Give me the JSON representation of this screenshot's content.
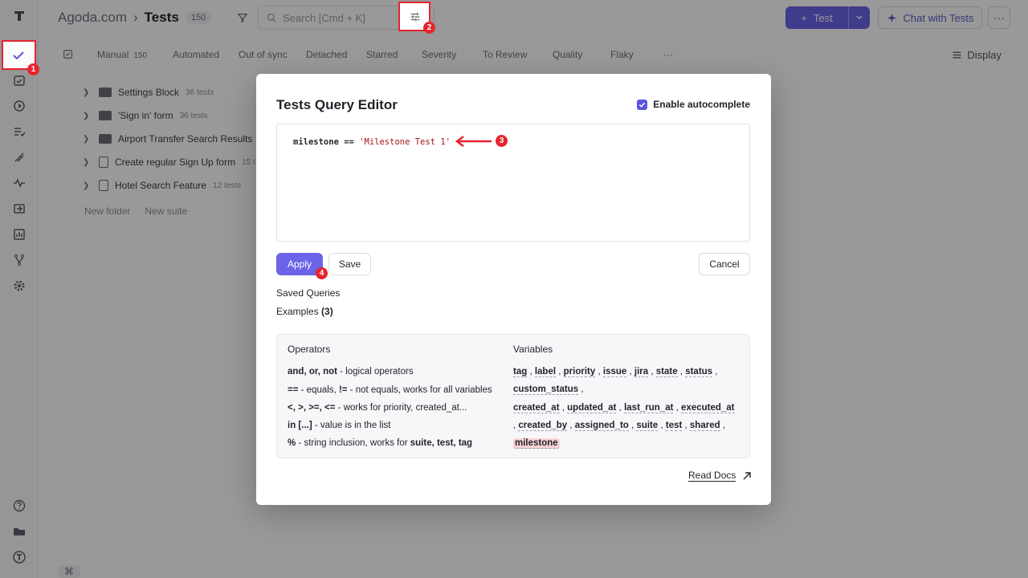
{
  "header": {
    "breadcrumb_root": "Agoda.com",
    "breadcrumb_sep": "›",
    "page_title": "Tests",
    "count": "150",
    "search_placeholder": "Search [Cmd + K]",
    "new_test_label": "Test",
    "chat_label": "Chat with Tests",
    "more_label": "···"
  },
  "tabs": [
    {
      "label": "Manual",
      "count": "150"
    },
    {
      "label": "Automated"
    },
    {
      "label": "Out of sync"
    },
    {
      "label": "Detached"
    },
    {
      "label": "Starred"
    },
    {
      "label": "Severity"
    },
    {
      "label": "To Review"
    },
    {
      "label": "Quality"
    },
    {
      "label": "Flaky"
    },
    {
      "label": "···"
    }
  ],
  "display_label": "Display",
  "tree": [
    {
      "label": "Settings Block",
      "meta": "36 tests",
      "kind": "folder"
    },
    {
      "label": "'Sign in' form",
      "meta": "36 tests",
      "kind": "folder"
    },
    {
      "label": "Airport Transfer Search Results",
      "meta": "",
      "kind": "folder"
    },
    {
      "label": "Create regular Sign Up form",
      "meta": "15 t",
      "kind": "doc"
    },
    {
      "label": "Hotel Search Feature",
      "meta": "12 tests",
      "kind": "doc"
    }
  ],
  "tree_actions": {
    "new_folder": "New folder",
    "new_suite": "New suite"
  },
  "modal": {
    "title": "Tests Query Editor",
    "autocomplete_label": "Enable autocomplete",
    "query_key": "milestone",
    "query_op": " == ",
    "query_value": "'Milestone Test 1'",
    "apply": "Apply",
    "save": "Save",
    "cancel": "Cancel",
    "saved_queries": "Saved Queries",
    "examples_label": "Examples",
    "examples_count": "(3)",
    "operators_header": "Operators",
    "variables_header": "Variables",
    "read_docs": "Read Docs"
  },
  "operators": [
    {
      "bold": "and, or, not",
      "rest": " - logical operators"
    },
    {
      "bold": "==",
      "rest": " - equals, ",
      "bold2": "!=",
      "rest2": " - not equals, works for all variables"
    },
    {
      "bold": "<, >, >=, <=",
      "rest": " - works for priority, created_at..."
    },
    {
      "bold": "in [...]",
      "rest": " - value is in the list"
    },
    {
      "bold": "%",
      "rest": " - string inclusion, works for ",
      "bold2": "suite, test, tag"
    }
  ],
  "variables": {
    "line1": [
      "tag",
      "label",
      "priority",
      "issue",
      "jira",
      "state",
      "status"
    ],
    "line2": [
      "custom_status"
    ],
    "line3": [
      "created_at",
      "updated_at",
      "last_run_at",
      "executed_at"
    ],
    "line4": [
      "created_by",
      "assigned_to",
      "suite",
      "test",
      "shared"
    ],
    "line5": [
      "milestone"
    ]
  },
  "annotations": [
    "1",
    "2",
    "3",
    "4"
  ],
  "colors": {
    "accent": "#6b63e8",
    "annotation": "#e5242f",
    "highlight": "#f8d3d3"
  }
}
